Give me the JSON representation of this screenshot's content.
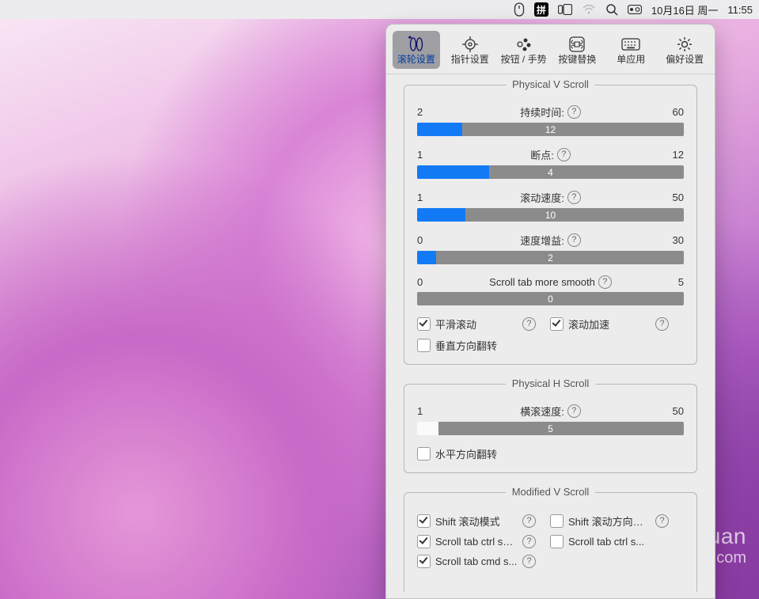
{
  "menubar": {
    "pinyin": "拼",
    "date": "10月16日 周一",
    "time": "11:55"
  },
  "tabs": [
    {
      "id": "scroll",
      "label": "滚轮设置"
    },
    {
      "id": "pointer",
      "label": "指针设置"
    },
    {
      "id": "buttons",
      "label": "按钮 / 手势"
    },
    {
      "id": "keyswap",
      "label": "按键替换"
    },
    {
      "id": "perapp",
      "label": "单应用"
    },
    {
      "id": "prefs",
      "label": "偏好设置"
    }
  ],
  "groups": {
    "vscroll_title": "Physical V Scroll",
    "hscroll_title": "Physical H Scroll",
    "mscroll_title": "Modified V Scroll"
  },
  "sliders": {
    "duration": {
      "label": "持续时间:",
      "min": "2",
      "max": "60",
      "value": "12",
      "fill": 17
    },
    "breakpoint": {
      "label": "断点:",
      "min": "1",
      "max": "12",
      "value": "4",
      "fill": 27
    },
    "speed": {
      "label": "滚动速度:",
      "min": "1",
      "max": "50",
      "value": "10",
      "fill": 18
    },
    "gain": {
      "label": "速度增益:",
      "min": "0",
      "max": "30",
      "value": "2",
      "fill": 7
    },
    "smooth": {
      "label": "Scroll tab more smooth",
      "min": "0",
      "max": "5",
      "value": "0",
      "fill": 0
    },
    "hspeed": {
      "label": "横滚速度:",
      "min": "1",
      "max": "50",
      "value": "5",
      "fill": 8,
      "white": true
    }
  },
  "checks": {
    "smooth_scroll": {
      "label": "平滑滚动",
      "on": true,
      "help": true
    },
    "accel": {
      "label": "滚动加速",
      "on": true,
      "help": true
    },
    "vflip": {
      "label": "垂直方向翻转",
      "on": false,
      "help": false
    },
    "hflip": {
      "label": "水平方向翻转",
      "on": false,
      "help": false
    },
    "shift_mode": {
      "label": "Shift 滚动模式",
      "on": true,
      "help": true
    },
    "shift_dir": {
      "label": "Shift 滚动方向…",
      "on": false,
      "help": true
    },
    "ctrl_scr_l": {
      "label": "Scroll tab ctrl scr...",
      "on": true,
      "help": true
    },
    "ctrl_scr_r": {
      "label": "Scroll tab ctrl s...",
      "on": false,
      "help": false
    },
    "cmd_scr": {
      "label": "Scroll tab cmd s...",
      "on": true,
      "help": true
    }
  },
  "watermark": {
    "line1": "aeziyuan",
    "line2": ".com"
  }
}
